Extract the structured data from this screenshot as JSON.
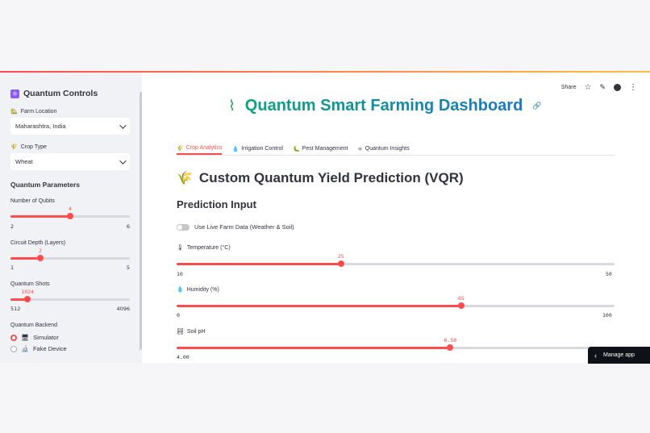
{
  "sidebar": {
    "title": "Quantum Controls",
    "farm_location": {
      "label": "Farm Location",
      "value": "Maharashtra, India"
    },
    "crop_type": {
      "label": "Crop Type",
      "value": "Wheat"
    },
    "quantum_params_heading": "Quantum Parameters",
    "qubits": {
      "label": "Number of Qubits",
      "value": "4",
      "min": "2",
      "max": "6",
      "fraction": 0.5
    },
    "depth": {
      "label": "Circuit Depth (Layers)",
      "value": "2",
      "min": "1",
      "max": "5",
      "fraction": 0.25
    },
    "shots": {
      "label": "Quantum Shots",
      "value": "1024",
      "min": "512",
      "max": "4096",
      "fraction": 0.143
    },
    "backend": {
      "label": "Quantum Backend",
      "options": [
        {
          "label": "Simulator",
          "selected": true
        },
        {
          "label": "Fake Device",
          "selected": false
        }
      ]
    }
  },
  "toolbar": {
    "share": "Share"
  },
  "page": {
    "title": "Quantum Smart Farming Dashboard",
    "tabs": [
      "Crop Analytics",
      "Irrigation Control",
      "Pest Management",
      "Quantum Insights"
    ],
    "active_tab": 0,
    "section_title": "Custom Quantum Yield Prediction (VQR)",
    "subsection_title": "Prediction Input",
    "toggle_label": "Use Live Farm Data (Weather & Soil)",
    "temperature": {
      "label": "Temperature (°C)",
      "value": "25",
      "min": "10",
      "max": "50",
      "fraction": 0.375
    },
    "humidity": {
      "label": "Humidity (%)",
      "value": "65",
      "min": "0",
      "max": "100",
      "fraction": 0.65
    },
    "soil_ph": {
      "label": "Soil pH",
      "value": "6.50",
      "min": "4.00",
      "fraction": 0.625
    }
  },
  "manage_app": "Manage app",
  "colors": {
    "accent": "#ff4b4b",
    "sidebar_bg": "#f0f2f6"
  }
}
